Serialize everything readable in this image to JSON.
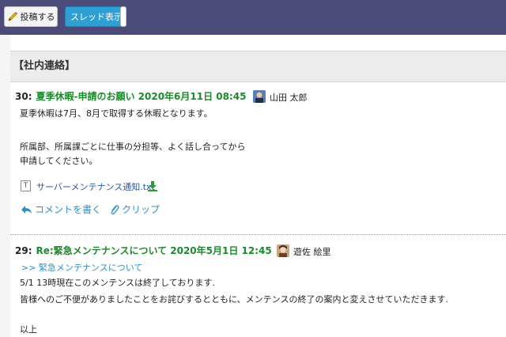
{
  "toolbar": {
    "post_button": "投稿する",
    "thread_button": "スレッド表示"
  },
  "section": {
    "title": "【社内連絡】"
  },
  "posts": [
    {
      "number": "30:",
      "title": "夏季休暇-申請のお願い 2020年6月11日 08:45",
      "author": "山田 太郎",
      "lines": [
        "夏季休暇は7月、8月で取得する休暇となります。",
        "所属部、所属課ごとに仕事の分担等、よく話し合ってから",
        "申請してください。"
      ],
      "attachment": "サーバーメンテナンス通知.txt",
      "actions": {
        "comment": "コメントを書く",
        "clip": "クリップ"
      }
    },
    {
      "number": "29:",
      "title": "Re:緊急メンテナンスについて 2020年5月1日 12:45",
      "author": "遊佐 絵里",
      "reply_link": ">> 緊急メンテナンスについて",
      "lines": [
        "5/1 13時現在このメンテンスは終了しております.",
        "皆様へのご不便がありましたことをお詫びするとともに、メンテンスの終了の案内と変えさせていただきます.",
        "以上"
      ]
    }
  ],
  "icons": {
    "post": "pencil-icon",
    "file": "text-file-icon",
    "download": "download-icon",
    "comment": "reply-arrow-icon",
    "clip": "paperclip-icon"
  },
  "colors": {
    "toolbar": "#4a4b78",
    "title_green": "#1a8a2a",
    "link_blue": "#2b8fc9",
    "thread_button": "#2f9fd2"
  }
}
